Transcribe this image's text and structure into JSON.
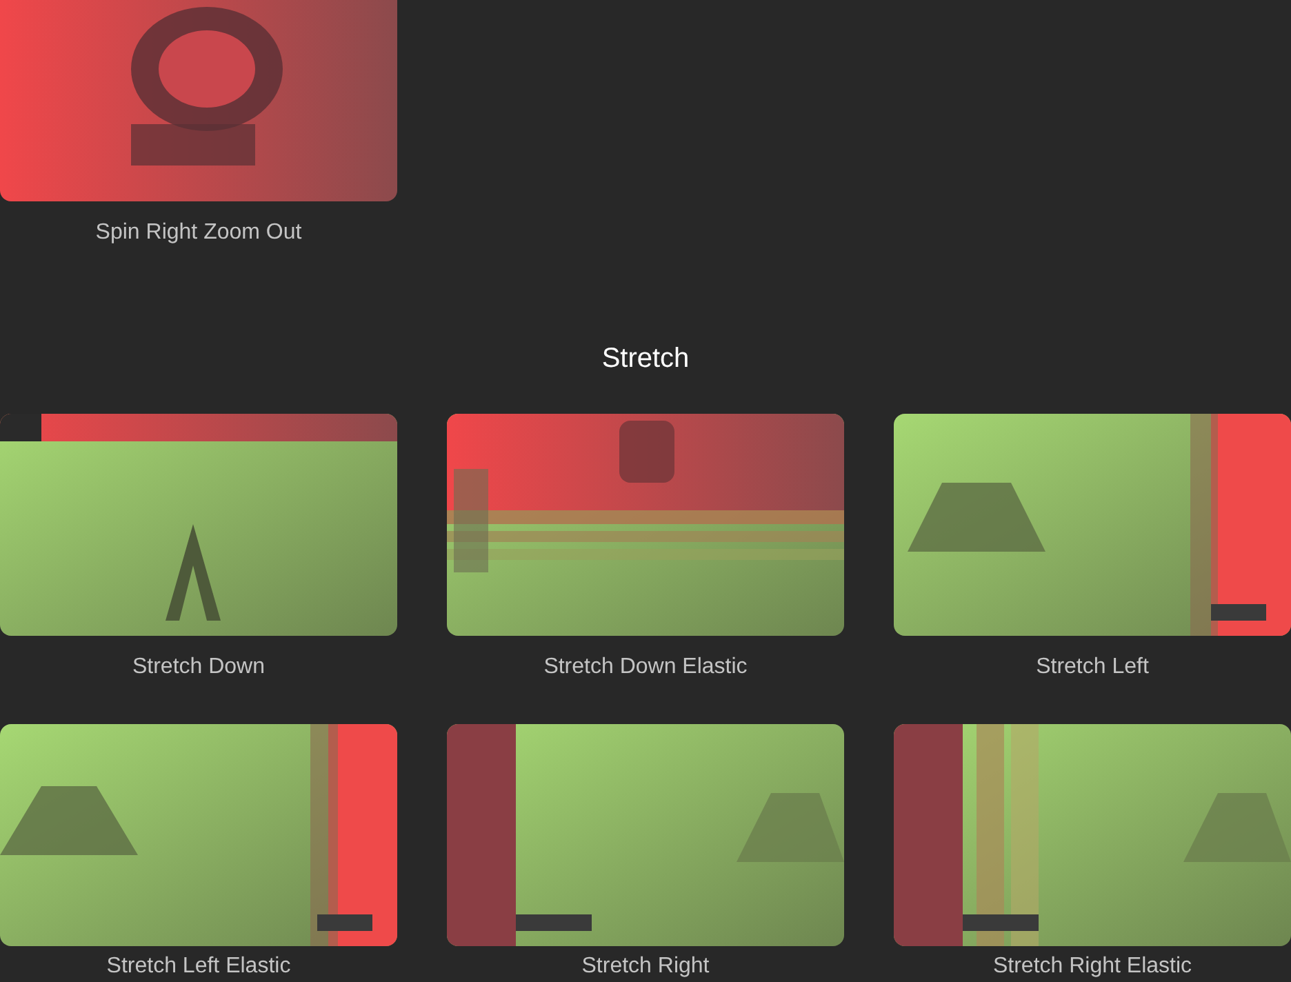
{
  "top_items": [
    {
      "label": "Spin Right Zoom Out"
    }
  ],
  "section": {
    "title": "Stretch",
    "items": [
      {
        "label": "Stretch Down"
      },
      {
        "label": "Stretch Down Elastic"
      },
      {
        "label": "Stretch Left"
      },
      {
        "label": "Stretch Left Elastic"
      },
      {
        "label": "Stretch Right"
      },
      {
        "label": "Stretch Right Elastic"
      }
    ]
  }
}
